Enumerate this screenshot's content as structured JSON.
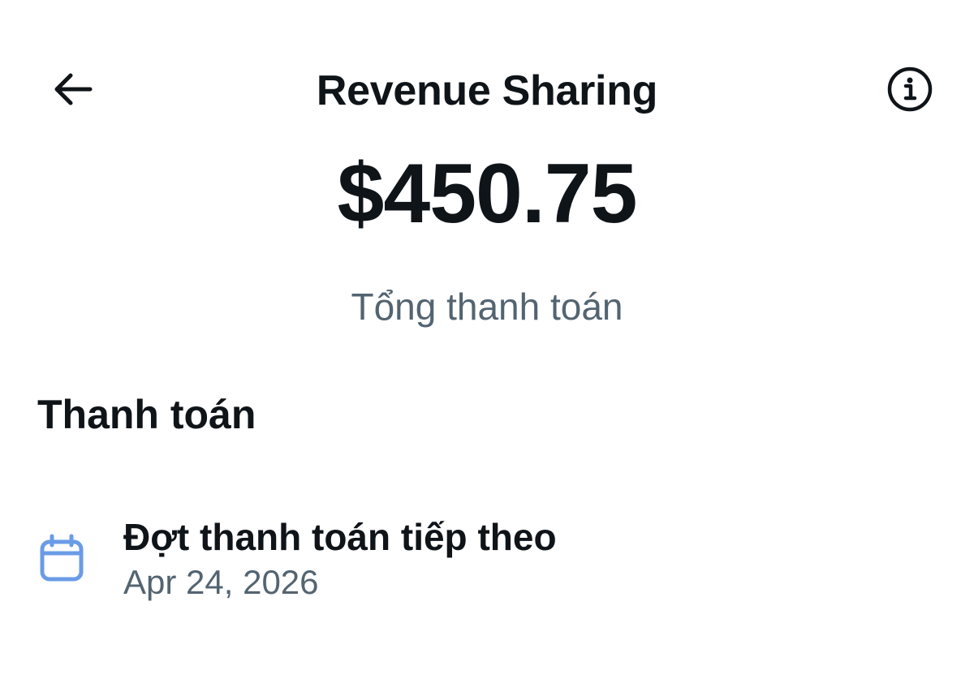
{
  "header": {
    "title": "Revenue Sharing",
    "back_icon": "arrow-left-icon",
    "info_icon": "info-icon"
  },
  "summary": {
    "amount": "$450.75",
    "label": "Tổng thanh toán"
  },
  "payouts": {
    "section_title": "Thanh toán",
    "next_payout": {
      "icon": "calendar-icon",
      "title": "Đợt thanh toán tiếp theo",
      "date": "Apr 24, 2026"
    }
  },
  "colors": {
    "text_primary": "#0f1419",
    "text_secondary": "#536471",
    "accent_icon": "#6a9be6"
  }
}
